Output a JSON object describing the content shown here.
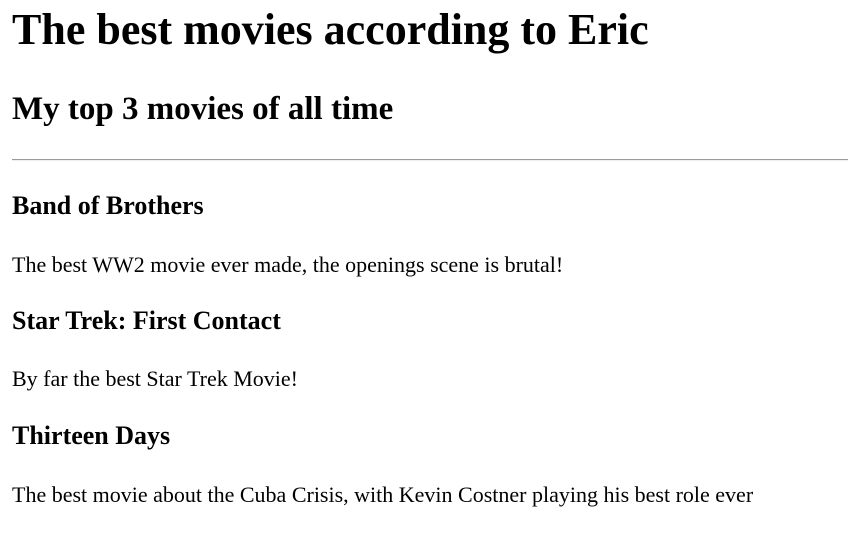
{
  "page": {
    "title": "The best movies according to Eric",
    "subtitle": "My top 3 movies of all time"
  },
  "movies": [
    {
      "title": "Band of Brothers",
      "description": "The best WW2 movie ever made, the openings scene is brutal!"
    },
    {
      "title": "Star Trek: First Contact",
      "description": "By far the best Star Trek Movie!"
    },
    {
      "title": "Thirteen Days",
      "description": "The best movie about the Cuba Crisis, with Kevin Costner playing his best role ever"
    }
  ]
}
